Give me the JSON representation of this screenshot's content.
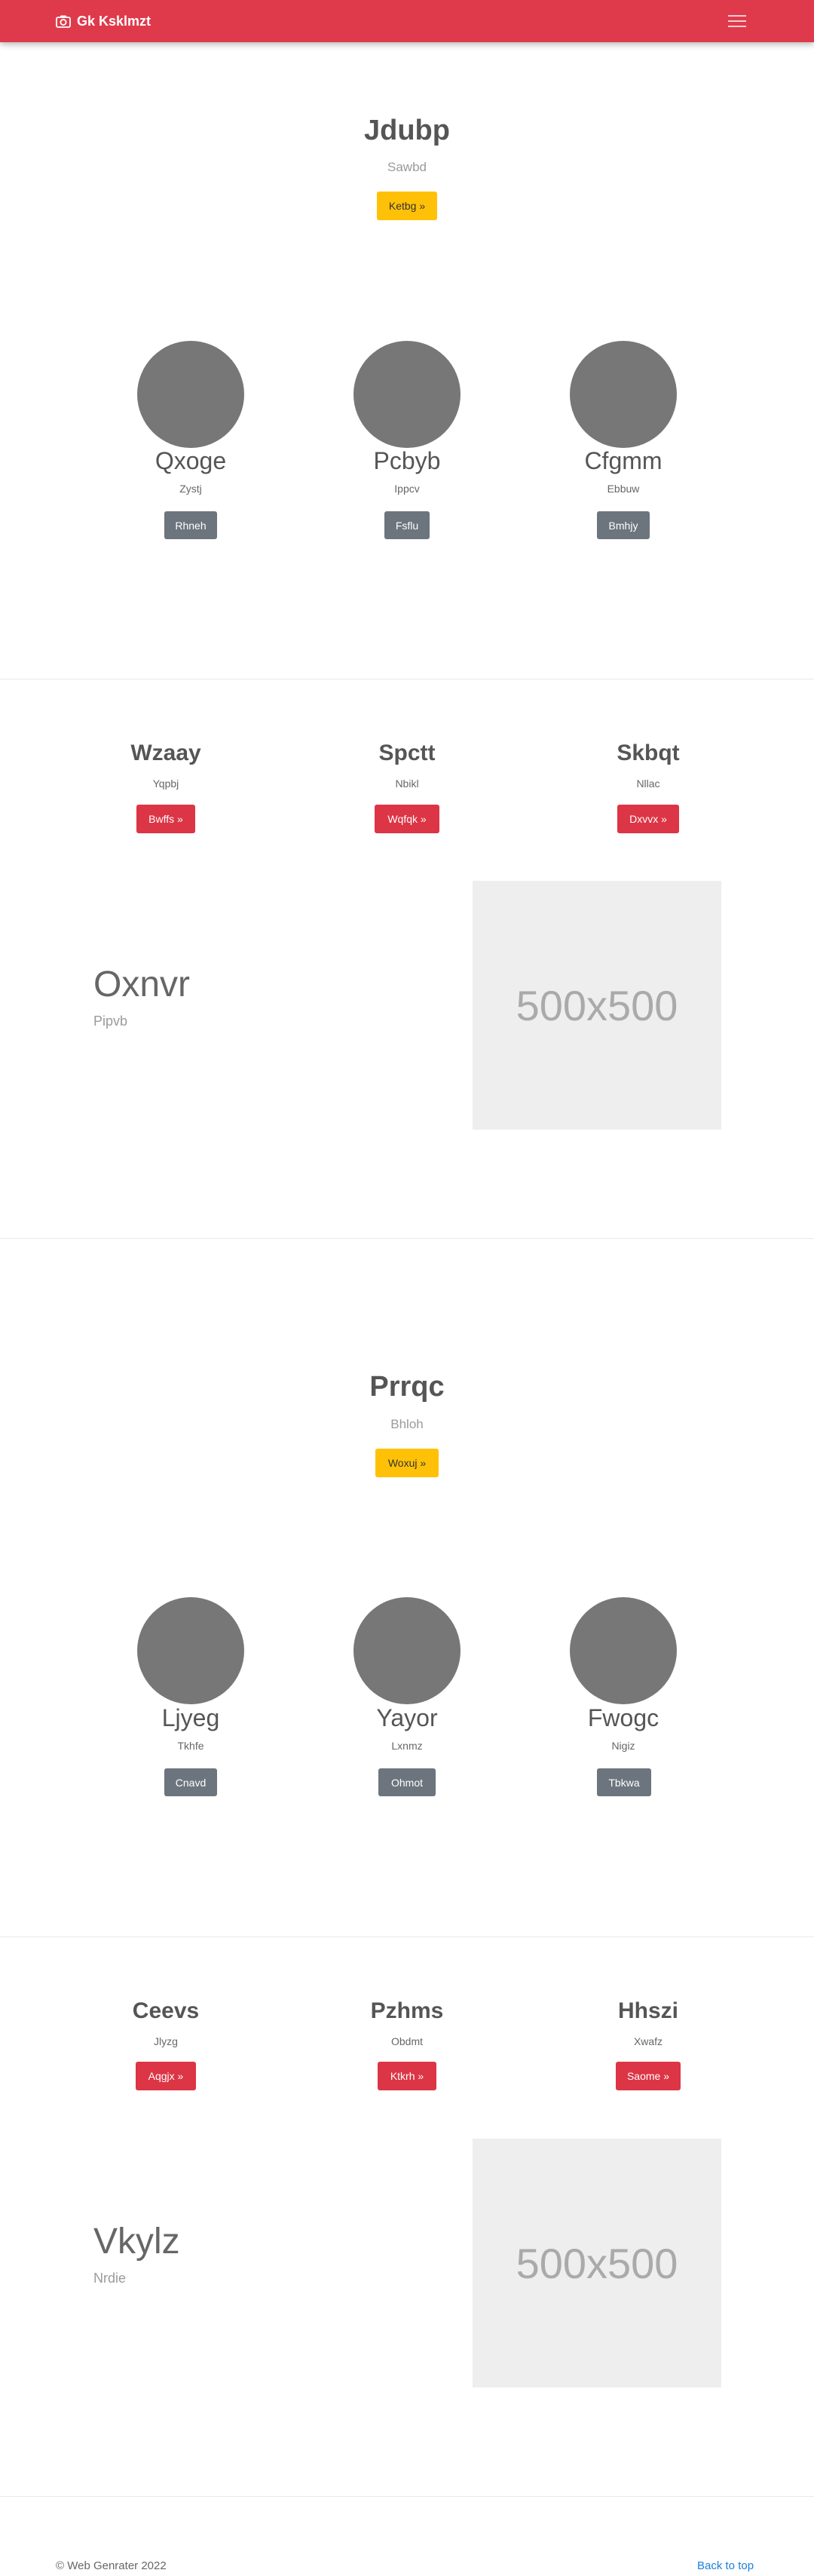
{
  "navbar": {
    "brand": "Gk Ksklmzt",
    "brand_icon": "camera-icon",
    "toggler_icon": "hamburger-menu-icon",
    "color": "#df3a4c"
  },
  "sections": {
    "hero1": {
      "title": "Jdubp",
      "subtitle": "Sawbd",
      "button": "Ketbg »"
    },
    "team1": [
      {
        "name": "Qxoge",
        "sub": "Zystj",
        "button": "Rhneh"
      },
      {
        "name": "Pcbyb",
        "sub": "Ippcv",
        "button": "Fsflu"
      },
      {
        "name": "Cfgmm",
        "sub": "Ebbuw",
        "button": "Bmhjy"
      }
    ],
    "features1": [
      {
        "title": "Wzaay",
        "sub": "Yqpbj",
        "button": "Bwffs »"
      },
      {
        "title": "Spctt",
        "sub": "Nbikl",
        "button": "Wqfqk »"
      },
      {
        "title": "Skbqt",
        "sub": "Nllac",
        "button": "Dxvvx »"
      }
    ],
    "media1": {
      "title": "Oxnvr",
      "subtitle": "Pipvb",
      "image_label": "500x500"
    },
    "hero2": {
      "title": "Prrqc",
      "subtitle": "Bhloh",
      "button": "Woxuj »"
    },
    "team2": [
      {
        "name": "Ljyeg",
        "sub": "Tkhfe",
        "button": "Cnavd"
      },
      {
        "name": "Yayor",
        "sub": "Lxnmz",
        "button": "Ohmot"
      },
      {
        "name": "Fwogc",
        "sub": "Nigiz",
        "button": "Tbkwa"
      }
    ],
    "features2": [
      {
        "title": "Ceevs",
        "sub": "Jlyzg",
        "button": "Aqgjx »"
      },
      {
        "title": "Pzhms",
        "sub": "Obdmt",
        "button": "Ktkrh »"
      },
      {
        "title": "Hhszi",
        "sub": "Xwafz",
        "button": "Saome »"
      }
    ],
    "media2": {
      "title": "Vkylz",
      "subtitle": "Nrdie",
      "image_label": "500x500"
    }
  },
  "footer": {
    "copyright": "© Web Genrater 2022",
    "back_to_top": "Back to top"
  }
}
